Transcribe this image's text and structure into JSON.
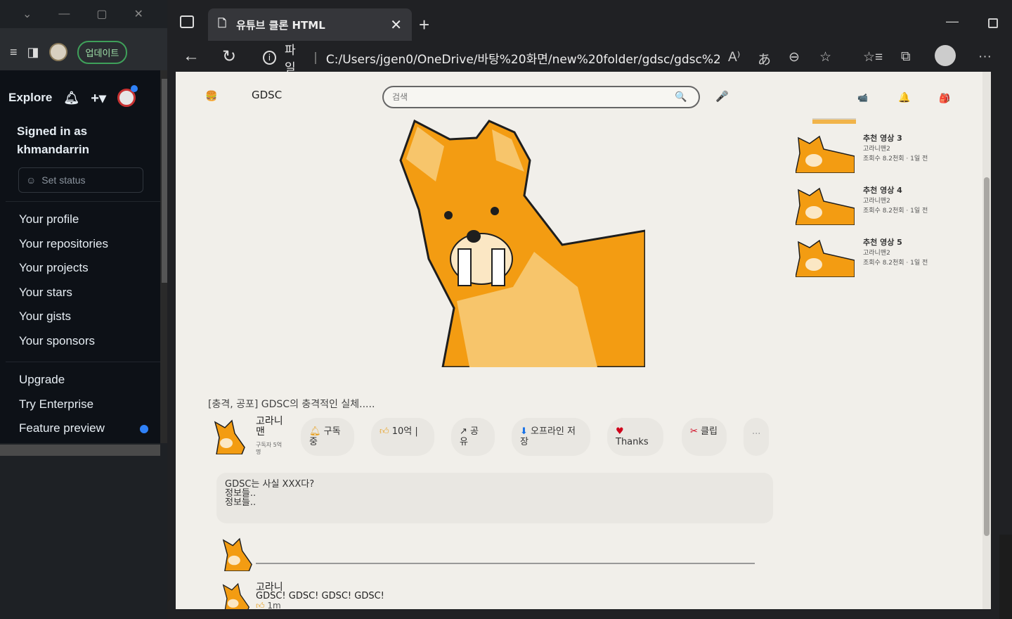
{
  "github": {
    "update_label": "업데이트",
    "explore": "Explore",
    "signed_in_as": "Signed in as",
    "username": "khmandarrin",
    "set_status": "Set status",
    "menu": [
      "Your profile",
      "Your repositories",
      "Your projects",
      "Your stars",
      "Your gists",
      "Your sponsors"
    ],
    "menu2": [
      "Upgrade",
      "Try Enterprise",
      "Feature preview"
    ]
  },
  "browser": {
    "tab_title": "유튜브 클론 HTML",
    "addr_label": "파일",
    "url": "C:/Users/jgen0/OneDrive/바탕%20화면/new%20folder/gdsc/gdsc%200..."
  },
  "yt": {
    "brand": "GDSC",
    "search_placeholder": "검색",
    "video_title": "[충격, 공포] GDSC의 충격적인 실체.....",
    "channel_name": "고라니맨",
    "channel_subs": "구독자 5억명",
    "actions": [
      {
        "icon": "bell",
        "label": "구독중"
      },
      {
        "icon": "thumb",
        "label": "10억 |"
      },
      {
        "icon": "share",
        "label": "공유"
      },
      {
        "icon": "download",
        "label": "오프라인 저장"
      },
      {
        "icon": "heart",
        "label": "Thanks"
      },
      {
        "icon": "scissors",
        "label": "클립"
      },
      {
        "icon": "more",
        "label": "..."
      }
    ],
    "description": [
      "GDSC는 사실 XXX다?",
      "정보들..",
      "정보들.."
    ],
    "recommendations": [
      {
        "title": "추천 영상 3",
        "channel": "고라니맨2",
        "meta": "조회수 8.2천회 · 1일 전"
      },
      {
        "title": "추천 영상 4",
        "channel": "고라니맨2",
        "meta": "조회수 8.2천회 · 1일 전"
      },
      {
        "title": "추천 영상 5",
        "channel": "고라니맨2",
        "meta": "조회수 8.2천회 · 1일 전"
      }
    ],
    "comment": {
      "author": "고라니",
      "text": "GDSC! GDSC! GDSC! GDSC!",
      "time": "1m"
    }
  },
  "colors": {
    "accent_orange": "#f39c12",
    "light_orange": "#f7c56b",
    "outline": "#1e1e1e"
  }
}
